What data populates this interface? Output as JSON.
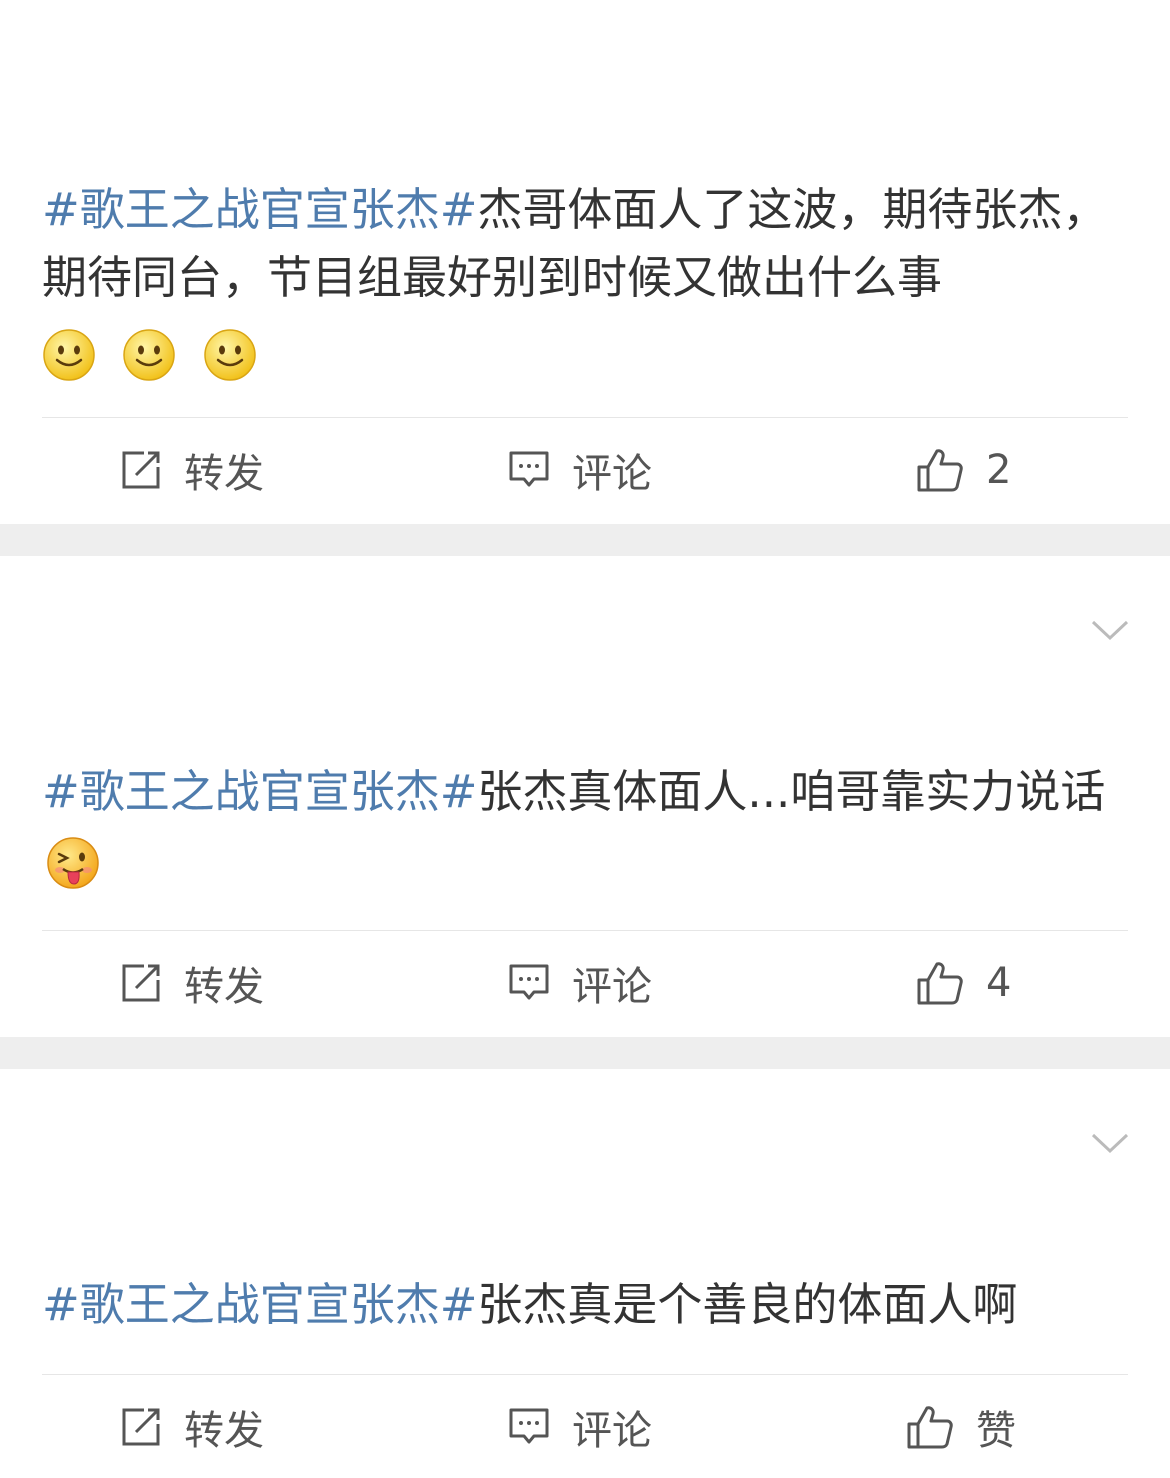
{
  "posts": [
    {
      "topic": "#歌王之战官宣张杰#",
      "body": "杰哥体面人了这波，期待张杰，期待同台，节目组最好别到时候又做出什么事",
      "emojis": [
        "smile",
        "smile",
        "smile"
      ],
      "actions": {
        "repost_label": "转发",
        "comment_label": "评论",
        "like_value": "2"
      }
    },
    {
      "topic": "#歌王之战官宣张杰#",
      "body": "张杰真体面人...咱哥靠实力说话",
      "emojis": [
        "tongue-wink"
      ],
      "actions": {
        "repost_label": "转发",
        "comment_label": "评论",
        "like_value": "4"
      }
    },
    {
      "topic": "#歌王之战官宣张杰#",
      "body": "张杰真是个善良的体面人啊",
      "emojis": [],
      "actions": {
        "repost_label": "转发",
        "comment_label": "评论",
        "like_value": "赞"
      }
    }
  ],
  "icons": {
    "repost": "repost-icon",
    "comment": "comment-icon",
    "like": "thumbs-up-icon",
    "more": "chevron-down-icon"
  },
  "colors": {
    "topic": "#4f7cad",
    "text": "#333333",
    "separator": "#eeeeee",
    "icon": "#555555"
  }
}
